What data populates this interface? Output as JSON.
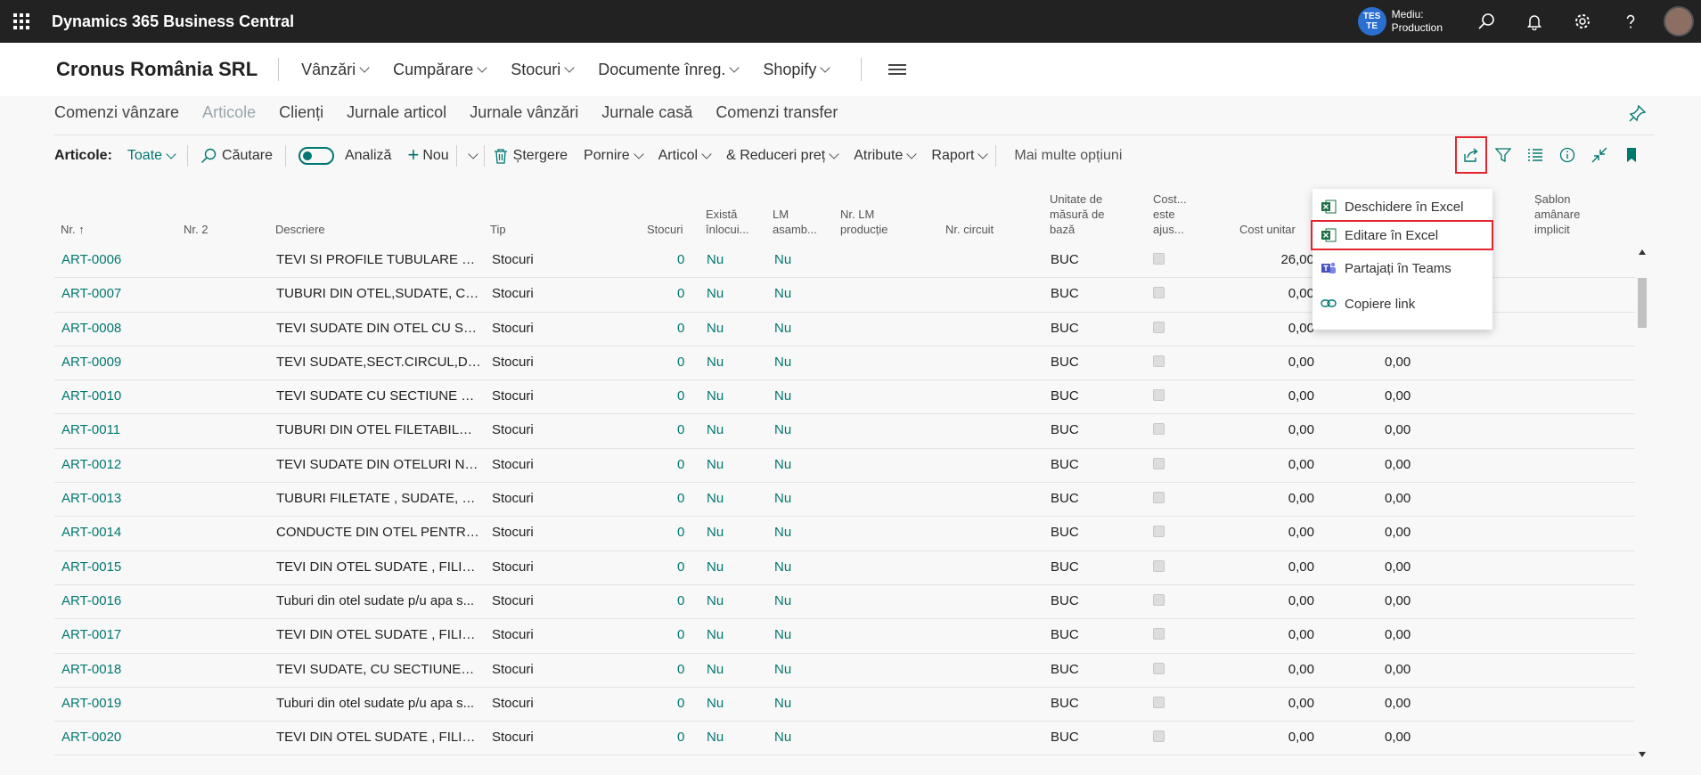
{
  "app": {
    "title": "Dynamics 365 Business Central"
  },
  "env": {
    "badge": "TES\nTE",
    "badge_line1": "TES",
    "badge_line2": "TE",
    "label_line1": "Mediu:",
    "label_line2": "Production"
  },
  "header": {
    "company": "Cronus România SRL",
    "menus": [
      "Vânzări",
      "Cumpărare",
      "Stocuri",
      "Documente înreg.",
      "Shopify"
    ]
  },
  "nav": {
    "items": [
      "Comenzi vânzare",
      "Articole",
      "Clienți",
      "Jurnale articol",
      "Jurnale vânzări",
      "Jurnale casă",
      "Comenzi transfer"
    ]
  },
  "actions": {
    "label": "Articole:",
    "view": "Toate",
    "search": "Căutare",
    "analysis": "Analiză",
    "new": "Nou",
    "delete": "Ștergere",
    "start": "Pornire",
    "item": "Articol",
    "discounts": "& Reduceri preț",
    "attributes": "Atribute",
    "report": "Raport",
    "more": "Mai multe opțiuni"
  },
  "columns": {
    "nr": "Nr.",
    "nr2": "Nr. 2",
    "desc": "Descriere",
    "tip": "Tip",
    "stocuri": "Stocuri",
    "exista_1": "Există",
    "exista_2": "înlocui...",
    "lm_1": "LM",
    "lm_2": "asamb...",
    "nrlm_1": "Nr. LM",
    "nrlm_2": "producție",
    "circuit": "Nr. circuit",
    "um_1": "Unitate de",
    "um_2": "măsură de",
    "um_3": "bază",
    "cost_1": "Cost...",
    "cost_2": "este",
    "cost_3": "ajus...",
    "cost_unitar": "Cost unitar",
    "sablon_1": "Șablon",
    "sablon_2": "amânare",
    "sablon_3": "implicit"
  },
  "rows": [
    {
      "nr": "ART-0006",
      "desc": "TEVI SI PROFILE TUBULARE DIN...",
      "tip": "Stocuri",
      "stoc": "0",
      "exista": "Nu",
      "lm": "Nu",
      "um": "BUC",
      "cost": "26,00",
      "cost2": ""
    },
    {
      "nr": "ART-0007",
      "desc": "TUBURI DIN OTEL,SUDATE, CU ...",
      "tip": "Stocuri",
      "stoc": "0",
      "exista": "Nu",
      "lm": "Nu",
      "um": "BUC",
      "cost": "0,00",
      "cost2": ""
    },
    {
      "nr": "ART-0008",
      "desc": "TEVI SUDATE DIN OTEL CU SEC...",
      "tip": "Stocuri",
      "stoc": "0",
      "exista": "Nu",
      "lm": "Nu",
      "um": "BUC",
      "cost": "0,00",
      "cost2": ""
    },
    {
      "nr": "ART-0009",
      "desc": "TEVI SUDATE,SECT.CIRCUL,DIN ...",
      "tip": "Stocuri",
      "stoc": "0",
      "exista": "Nu",
      "lm": "Nu",
      "um": "BUC",
      "cost": "0,00",
      "cost2": "0,00"
    },
    {
      "nr": "ART-0010",
      "desc": "TEVI SUDATE CU SECTIUNE CIR...",
      "tip": "Stocuri",
      "stoc": "0",
      "exista": "Nu",
      "lm": "Nu",
      "um": "BUC",
      "cost": "0,00",
      "cost2": "0,00"
    },
    {
      "nr": "ART-0011",
      "desc": "TUBURI DIN OTEL FILETABILA, A...",
      "tip": "Stocuri",
      "stoc": "0",
      "exista": "Nu",
      "lm": "Nu",
      "um": "BUC",
      "cost": "0,00",
      "cost2": "0,00"
    },
    {
      "nr": "ART-0012",
      "desc": "TEVI SUDATE DIN OTELURI NEA...",
      "tip": "Stocuri",
      "stoc": "0",
      "exista": "Nu",
      "lm": "Nu",
      "um": "BUC",
      "cost": "0,00",
      "cost2": "0,00"
    },
    {
      "nr": "ART-0013",
      "desc": "TUBURI FILETATE , SUDATE, CU ...",
      "tip": "Stocuri",
      "stoc": "0",
      "exista": "Nu",
      "lm": "Nu",
      "um": "BUC",
      "cost": "0,00",
      "cost2": "0,00"
    },
    {
      "nr": "ART-0014",
      "desc": "CONDUCTE DIN OTEL PENTRU ...",
      "tip": "Stocuri",
      "stoc": "0",
      "exista": "Nu",
      "lm": "Nu",
      "um": "BUC",
      "cost": "0,00",
      "cost2": "0,00"
    },
    {
      "nr": "ART-0015",
      "desc": "TEVI DIN OTEL SUDATE , FILITA...",
      "tip": "Stocuri",
      "stoc": "0",
      "exista": "Nu",
      "lm": "Nu",
      "um": "BUC",
      "cost": "0,00",
      "cost2": "0,00"
    },
    {
      "nr": "ART-0016",
      "desc": "Tuburi din otel sudate p/u apa s...",
      "tip": "Stocuri",
      "stoc": "0",
      "exista": "Nu",
      "lm": "Nu",
      "um": "BUC",
      "cost": "0,00",
      "cost2": "0,00"
    },
    {
      "nr": "ART-0017",
      "desc": "TEVI DIN OTEL SUDATE , FILITA...",
      "tip": "Stocuri",
      "stoc": "0",
      "exista": "Nu",
      "lm": "Nu",
      "um": "BUC",
      "cost": "0,00",
      "cost2": "0,00"
    },
    {
      "nr": "ART-0018",
      "desc": "TEVI SUDATE, CU SECTIUNEA CI...",
      "tip": "Stocuri",
      "stoc": "0",
      "exista": "Nu",
      "lm": "Nu",
      "um": "BUC",
      "cost": "0,00",
      "cost2": "0,00"
    },
    {
      "nr": "ART-0019",
      "desc": "Tuburi din otel sudate p/u apa s...",
      "tip": "Stocuri",
      "stoc": "0",
      "exista": "Nu",
      "lm": "Nu",
      "um": "BUC",
      "cost": "0,00",
      "cost2": "0,00"
    },
    {
      "nr": "ART-0020",
      "desc": "TEVI DIN OTEL SUDATE , FILITA...",
      "tip": "Stocuri",
      "stoc": "0",
      "exista": "Nu",
      "lm": "Nu",
      "um": "BUC",
      "cost": "0,00",
      "cost2": "0,00"
    }
  ],
  "share_menu": {
    "items": [
      "Deschidere în Excel",
      "Editare în Excel",
      "Partajați în Teams",
      "Copiere link"
    ]
  },
  "colors": {
    "accent": "#00776f",
    "topbar": "#222222",
    "highlight": "#e3262e"
  }
}
